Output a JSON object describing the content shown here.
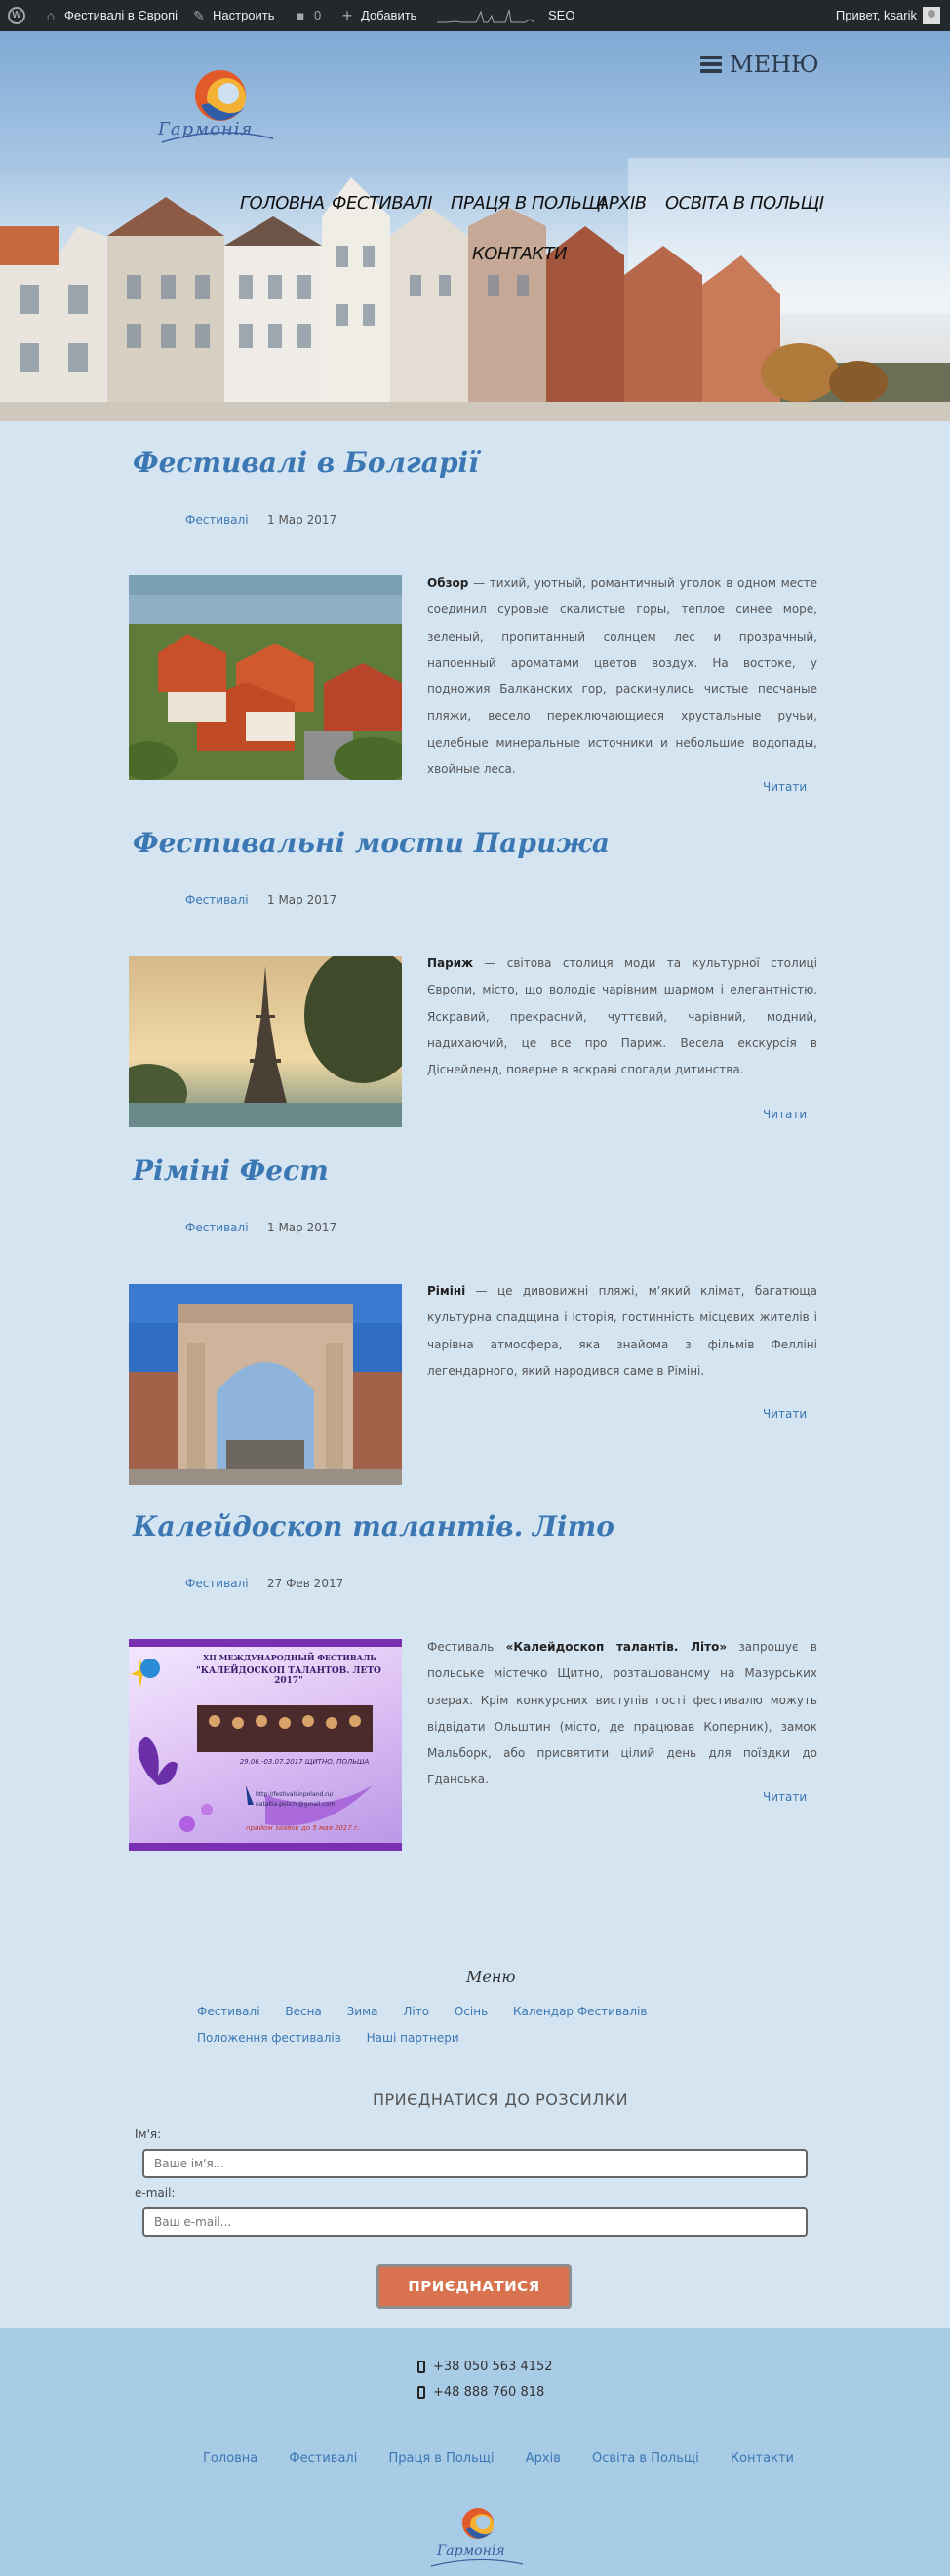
{
  "adminbar": {
    "site_name": "Фестивалі в Європі",
    "customize": "Настроить",
    "comments_count": "0",
    "add_new": "Добавить",
    "seo": "SEO",
    "greeting": "Привет, ksarik"
  },
  "header": {
    "menu_label": "МЕНЮ",
    "logo_text": "Гармонія",
    "nav": [
      "Головна",
      "Фестивалі",
      "Праця в Польщі",
      "Архів",
      "Освіта в Польщі",
      "Контакти"
    ]
  },
  "posts": [
    {
      "title": "Фестивалі в Болгарії",
      "category": "Фестивалі",
      "date": "1 Мар 2017",
      "lead": "Обзор",
      "text": " — тихий, уютный, романтичный уголок в одном месте соединил суровые скалистые горы, теплое синее море, зеленый, пропитанный солнцем лес и прозрачный, напоенный ароматами цветов воздух. На востоке, у подножия Балканских гор, раскинулись чистые песчаные пляжи, весело переключающиеся хрустальные ручьи, целебные минеральные источники и небольшие водопады, хвойные леса.",
      "read_more": "Читати"
    },
    {
      "title": "Фестивальні мости Парижа",
      "category": "Фестивалі",
      "date": "1 Мар 2017",
      "lead": "Париж",
      "text": " — світова столиця моди та культурної столиці Європи,  місто, що володіє чарівним шармом і елегантністю. Яскравий, прекрасний, чуттєвий, чарівний, модний, надихаючий, це все про Париж. Весела екскурсія в Діснейленд, поверне в яскраві спогади дитинства.",
      "read_more": "Читати"
    },
    {
      "title": "Ріміні Фест",
      "category": "Фестивалі",
      "date": "1 Мар 2017",
      "lead": "Ріміні",
      "text": " — це дивовижні пляжі, м’який клімат, багатюща культурна спадщина і історія, гостинність місцевих жителів і чарівна атмосфера, яка знайома з фільмів Фелліні легендарного, який народився саме в Ріміні.",
      "read_more": "Читати"
    },
    {
      "title": "Калейдоскоп талантів. Літо",
      "category": "Фестивалі",
      "date": "27 Фев 2017",
      "pre": "Фестиваль ",
      "lead": "«Калейдоскоп талантів. Літо»",
      "text": " запрошує в польське містечко Щитно, розташованому на Мазурських озерах. Крім конкурсних виступів гості фестивалю можуть відвідати Ольштин (місто, де працював Коперник), замок Мальборк, або присвятити цілий день для поїздки до Гданська.",
      "read_more": "Читати",
      "poster": {
        "line1": "XII МЕЖДУНАРОДНЫЙ ФЕСТИВАЛЬ",
        "line2": "\"КАЛЕЙДОСКОП ТАЛАНТОВ. ЛЕТО 2017\"",
        "line3": "29.06.-03.07.2017 ЩИТНО, ПОЛЬША",
        "line4": "http://festivalsinpoland.ru/",
        "line5": "natallia.polichl@gmail.com",
        "line6": "прийом заявок до 5 мая 2017 г."
      }
    }
  ],
  "footer": {
    "menu_title": "Меню",
    "menu_items": [
      "Фестивалі",
      "Весна",
      "Зима",
      "Літо",
      "Осінь",
      "Календар Фестивалів",
      "Положення фестивалів",
      "Наші партнери"
    ],
    "subscribe_title": "ПРИЄДНАТИСЯ ДО РОЗСИЛКИ",
    "name_label": "Ім'я:",
    "name_placeholder": "Ваше ім'я...",
    "email_label": "e-mail:",
    "email_placeholder": "Ваш e-mail...",
    "subscribe_button": "ПРИЄДНАТИСЯ",
    "phones": [
      "+38 050 563 4152",
      "+48 888 760 818"
    ],
    "bottom_nav": [
      "Головна",
      "Фестивалі",
      "Праця в Польщі",
      "Архів",
      "Освіта в Польщі",
      "Контакти"
    ],
    "logo_text": "Гармонія"
  },
  "colors": {
    "accent": "#3b77b3",
    "page_bg": "#d5e4f1",
    "admin_bar": "#23282d",
    "button": "#d9734f",
    "footer_bg": "#a8cbe6"
  }
}
